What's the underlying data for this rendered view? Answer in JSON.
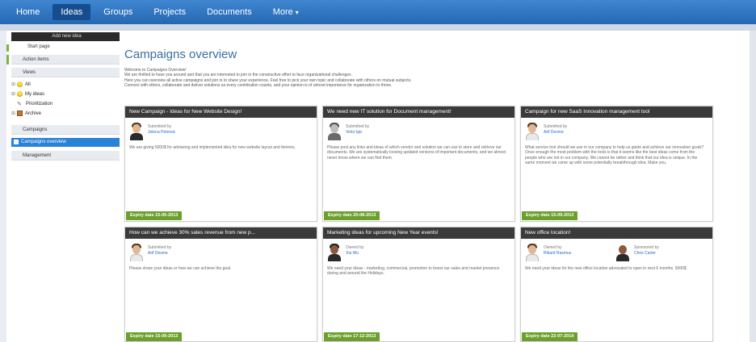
{
  "nav": {
    "items": [
      "Home",
      "Ideas",
      "Groups",
      "Projects",
      "Documents",
      "More"
    ],
    "active_index": 1
  },
  "sidebar": {
    "add_button": "Add new idea",
    "start_page": "Start page",
    "action_items": "Action items",
    "views": "Views",
    "tree": [
      "All",
      "My ideas",
      "Prioritization",
      "Archive"
    ],
    "campaigns": "Campaigns",
    "campaigns_overview": "Campaigns overview",
    "management": "Management"
  },
  "main": {
    "title": "Campaigns overview",
    "intro": [
      "Welcome to Campaigns Overview!",
      "We are thrilled to have you around and that you are interested to join in the constructive effort to face organizational challenges.",
      "Here you can overview all active campaigns and join in to share your experience. Feel free to pick your own topic and collaborate with others on mutual subjects.",
      "Connect with others, collaborate and deliver solutions as every contribution counts, and your opinion is of utmost importance for organization to thrive."
    ]
  },
  "cards": [
    {
      "title": "New Campaign - Ideas for New Website Design!",
      "people": [
        {
          "role": "Submitted by",
          "name": "Jelena Petrovic",
          "avatar": "woman"
        }
      ],
      "description": "We are giving 5000$ for adviseing and implemented idea for new website layout and themes.",
      "expiry": "Expiry date 15-05-2013"
    },
    {
      "title": "We need new IT solution for Document management!",
      "people": [
        {
          "role": "Submitted by",
          "name": "Velor Igic",
          "avatar": "gray"
        }
      ],
      "description": "Please post any links and ideas of which vendor and solution we can use to store and retrieve our documents. We are systematically loosing updated versions of important documents, and we almost never know where we can find them.",
      "expiry": "Expiry date 20-08-2013"
    },
    {
      "title": "Campaign for new SaaS Innovation management tool",
      "people": [
        {
          "role": "Submitted by",
          "name": "Arif Desme",
          "avatar": "man"
        }
      ],
      "description": "What service tool should we use in our company to help us guide and achieve our innovation goals? Once enough the most problem with the tools is that it seems like the best ideas come from the people who are not in our company. We cannot be rather and think that our idea is unique. In the same moment we came up with some potentially breakthrough idea. Make you.",
      "expiry": "Expiry date 15-09-2013"
    },
    {
      "title": "How can we achieve 30% sales revenue from new p...",
      "people": [
        {
          "role": "Submitted by",
          "name": "Arif Desme",
          "avatar": "man"
        }
      ],
      "description": "Please share your ideas or how we can achieve the goal.",
      "expiry": "Expiry date 15-09-2013"
    },
    {
      "title": "Marketing ideas for upcoming New Year events!",
      "people": [
        {
          "role": "Owned by",
          "name": "Xia Wu",
          "avatar": "dark-woman"
        }
      ],
      "description": "We need your ideas - marketing, commercial, promotion to boost our sales and market presence during and around the Holidays.",
      "expiry": "Expiry date 17-12-2013"
    },
    {
      "title": "New office location!",
      "people": [
        {
          "role": "Owned by",
          "name": "Rikard Rasmus",
          "avatar": "man"
        },
        {
          "role": "Sponsored by",
          "name": "Chris Carter",
          "avatar": "bald"
        }
      ],
      "description": "We need your ideas for the new office location advocated to open in next 6 months. 5000$",
      "expiry": "Expiry date 22-07-2014"
    }
  ],
  "colors": {
    "nav_bar": "#2e74c0",
    "card_header": "#3a3a3a",
    "expiry_badge": "#6ba02b",
    "selected_item": "#2a82d8",
    "title_text": "#3b6ea0"
  }
}
